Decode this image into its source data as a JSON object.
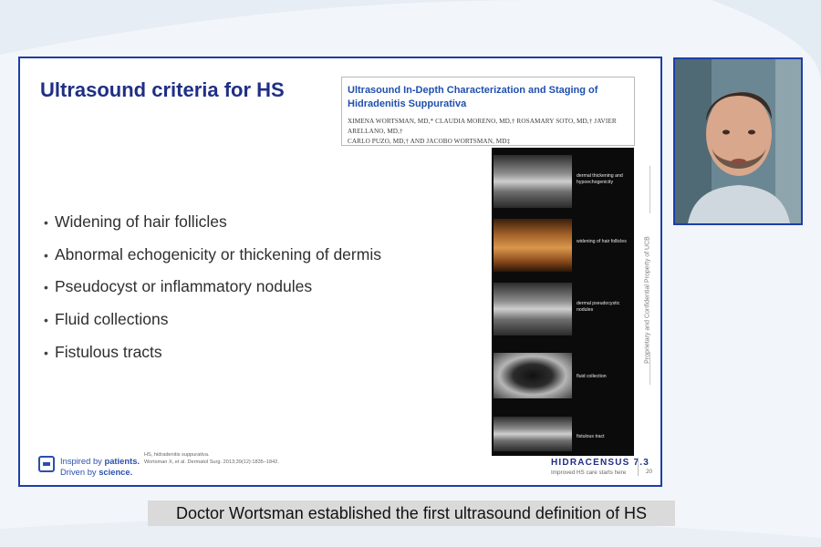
{
  "slide": {
    "title": "Ultrasound criteria for HS",
    "paper": {
      "title": "Ultrasound In-Depth Characterization and Staging of Hidradenitis Suppurativa",
      "authors_line1": "XIMENA WORTSMAN, MD,* CLAUDIA MORENO, MD,† ROSAMARY SOTO, MD,† JAVIER ARELLANO, MD,†",
      "authors_line2": "CARLO PUZO, MD,† AND JACOBO WORTSMAN, MD‡"
    },
    "bullets": [
      "Widening of hair follicles",
      "Abnormal echogenicity or thickening of dermis",
      "Pseudocyst or inflammatory nodules",
      "Fluid collections",
      "Fistulous tracts"
    ],
    "ultrasound_labels": [
      "dermal thickening and hypoechogenicity",
      "widening of hair follicles",
      "dermal pseudocystic nodules",
      "fluid collection",
      "fistulous tract"
    ],
    "side_text": "Proprietary and Confidential Property of UCB",
    "footer": {
      "tagline_line1_pre": "Inspired by ",
      "tagline_line1_bold": "patients.",
      "tagline_line2_pre": "Driven by ",
      "tagline_line2_bold": "science.",
      "footnote_line1": "HS, hidradenitis suppurativa.",
      "footnote_line2": "Wortsman X, et al. Dermatol Surg. 2013;39(12):1835–1842.",
      "brand": "HIDRACENSUS 7.3",
      "brand_sub": "Improved HS care starts here",
      "page_number": "20"
    }
  },
  "caption": "Doctor Wortsman established the first ultrasound definition of HS",
  "colors": {
    "accent": "#1e3ea8",
    "title": "#1f2f86",
    "paper_title": "#1f4fae"
  }
}
